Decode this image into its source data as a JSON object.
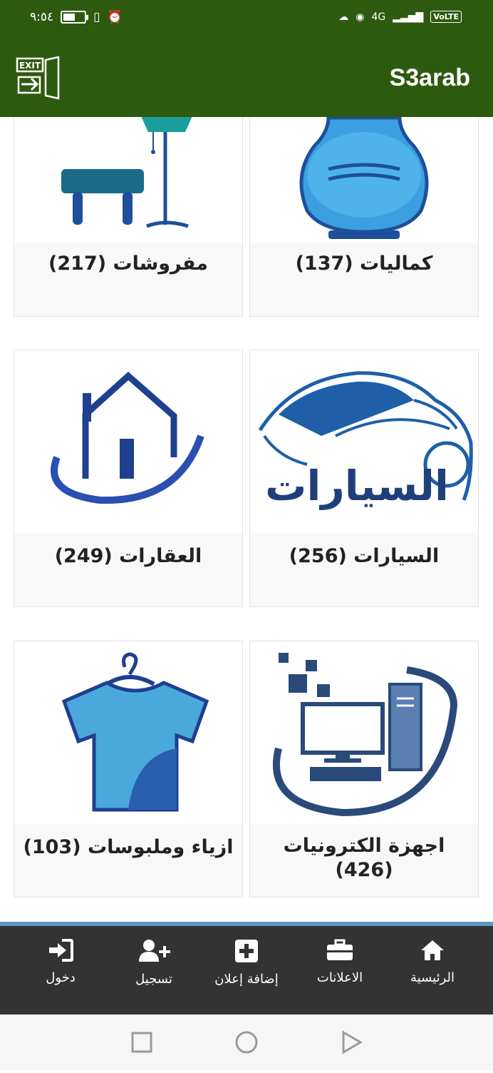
{
  "status": {
    "time": "٩:٥٤",
    "network": "4G",
    "volte": "VoLTE",
    "battery_level": 0.55
  },
  "app": {
    "title": "S3arab",
    "exit_label": "EXIT"
  },
  "categories": [
    {
      "id": "luxuries",
      "label": "كماليات (137)",
      "icon": "perfume-bottle-icon"
    },
    {
      "id": "furniture",
      "label": "مفروشات (217)",
      "icon": "furniture-lamp-icon"
    },
    {
      "id": "cars",
      "label": "السيارات (256)",
      "icon": "car-logo-icon",
      "image_text": "السيارات"
    },
    {
      "id": "realestate",
      "label": "العقارات (249)",
      "icon": "house-icon"
    },
    {
      "id": "electronics",
      "label": "اجهزة الكترونيات (426)",
      "line1": "اجهزة الكترونيات",
      "line2": "(426)",
      "icon": "computer-icon"
    },
    {
      "id": "fashion",
      "label": "ازياء وملبوسات (103)",
      "icon": "shirt-hanger-icon"
    }
  ],
  "bottom_nav": [
    {
      "id": "home",
      "label": "الرئيسية",
      "icon": "home-icon"
    },
    {
      "id": "ads",
      "label": "الاعلانات",
      "icon": "briefcase-icon"
    },
    {
      "id": "add-ad",
      "label": "إضافة إعلان",
      "icon": "plus-square-icon"
    },
    {
      "id": "register",
      "label": "تسجيل",
      "icon": "user-plus-icon"
    },
    {
      "id": "login",
      "label": "دخول",
      "icon": "sign-in-icon"
    }
  ],
  "colors": {
    "appbar": "#2e5a10",
    "bottom_nav": "#333333",
    "nav_accent": "#5b9ac3",
    "icon_blue": "#1f4f9a",
    "icon_light_blue": "#3aa0e0"
  }
}
